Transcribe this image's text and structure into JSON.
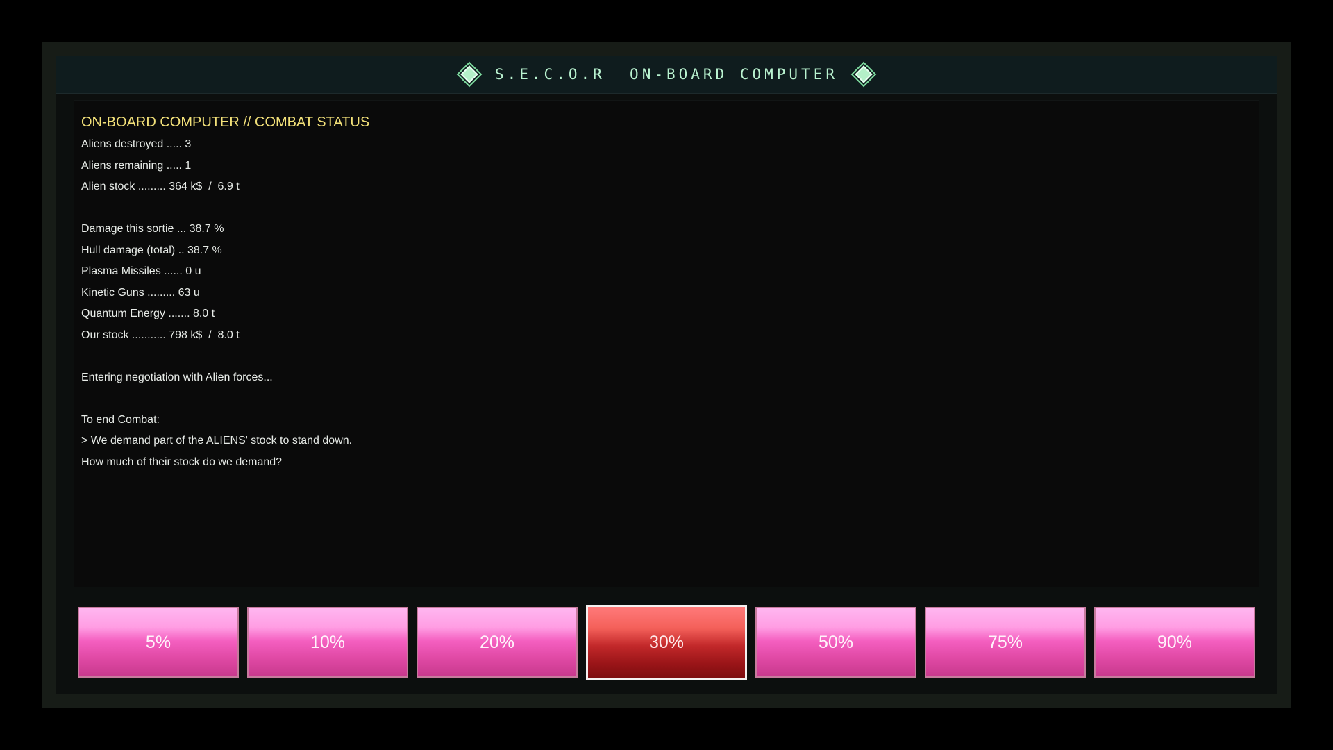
{
  "window": {
    "title": "S.E.C.O.R  ON-BOARD COMPUTER"
  },
  "console": {
    "heading": "ON-BOARD COMPUTER // COMBAT STATUS",
    "lines": [
      "Aliens destroyed ..... 3",
      "Aliens remaining ..... 1",
      "Alien stock ......... 364 k$  /  6.9 t",
      "",
      "Damage this sortie ... 38.7 %",
      "Hull damage (total) .. 38.7 %",
      "Plasma Missiles ...... 0 u",
      "Kinetic Guns ......... 63 u",
      "Quantum Energy ....... 8.0 t",
      "Our stock ........... 798 k$  /  8.0 t",
      "",
      "Entering negotiation with Alien forces...",
      "",
      "To end Combat:",
      "> We demand part of the ALIENS' stock to stand down.",
      "How much of their stock do we demand?"
    ]
  },
  "options": {
    "selected_index": 3,
    "items": [
      "5%",
      "10%",
      "20%",
      "30%",
      "50%",
      "75%",
      "90%"
    ]
  },
  "colors": {
    "title": "#b9f3d0",
    "heading": "#f4e27a",
    "text": "#e8ece8",
    "button": "#f45fc0",
    "button_selected": "#c2282a"
  },
  "icons": {
    "title_left": "diamond-icon",
    "title_right": "diamond-icon"
  }
}
